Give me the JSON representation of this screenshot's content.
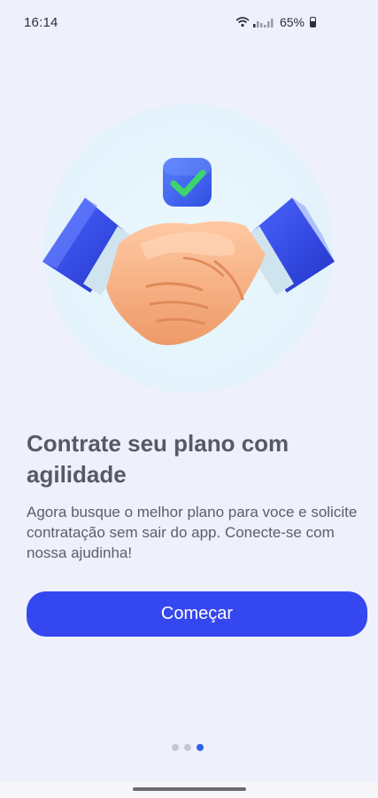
{
  "status_bar": {
    "time": "16:14",
    "battery_percent": "65%",
    "icons": [
      "wifi-icon",
      "signal-icon",
      "battery-icon"
    ]
  },
  "hero": {
    "illustration": "handshake-icon",
    "badge": "checkmark-icon",
    "colors": {
      "circle": "#e6f4fd",
      "sleeve": "#2f45e6",
      "skin": "#f6a878",
      "badge": "#3e66f0",
      "check": "#3dd56b"
    }
  },
  "onboarding": {
    "title": "Contrate seu plano com agilidade",
    "description": "Agora busque o melhor plano para voce e solicite contratação sem sair do app. Conecte-se com nossa ajudinha!",
    "start_button": "Começar",
    "page_count": 3,
    "current_page": 3
  },
  "colors": {
    "background": "#eef0fb",
    "primary": "#3547ef",
    "dot_active": "#2d63e6",
    "dot_inactive": "#c5c7cf"
  }
}
